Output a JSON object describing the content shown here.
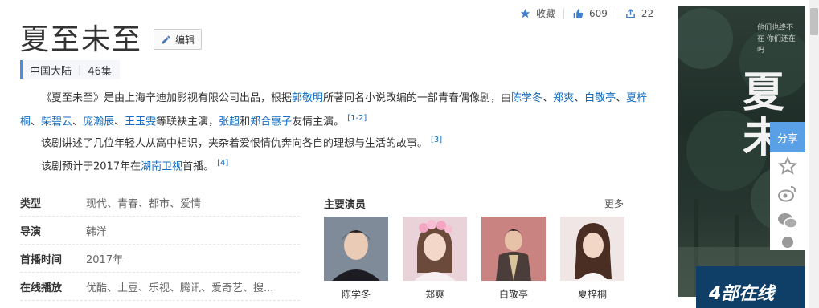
{
  "actions": {
    "favorite": "收藏",
    "likes": "609",
    "shares": "22"
  },
  "title": "夏至未至",
  "edit_label": "编辑",
  "tags": [
    "中国大陆",
    "46集"
  ],
  "intro": {
    "p1": {
      "s1": "《夏至未至》是由上海辛迪加影视有限公司出品，根据",
      "l1": "郭敬明",
      "s2": "所著同名小说改编的一部青春偶像剧，由",
      "l2": "陈学冬",
      "s3": "、",
      "l3": "郑爽",
      "s4": "、",
      "l4": "白敬亭",
      "s5": "、",
      "l5": "夏梓桐",
      "s6": "、",
      "l6": "柴碧云",
      "s7": "、",
      "l7": "庞瀚辰",
      "s8": "、",
      "l8": "王玉雯",
      "s9": "等联袂主演，",
      "l9": "张超",
      "s10": "和",
      "l10": "郑合惠子",
      "s11": "友情主演。",
      "ref": "[1-2]"
    },
    "p2": {
      "text": "该剧讲述了几位年轻人从高中相识，夹杂着爱恨情仇奔向各自的理想与生活的故事。",
      "ref": "[3]"
    },
    "p3": {
      "s1": "该剧预计于2017年在",
      "link": "湖南卫视",
      "s2": "首播。",
      "ref": "[4]"
    }
  },
  "info": [
    {
      "key": "类型",
      "value": "现代、青春、都市、爱情"
    },
    {
      "key": "导演",
      "value": "韩洋"
    },
    {
      "key": "首播时间",
      "value": "2017年"
    },
    {
      "key": "在线播放",
      "value": "优酷、土豆、乐视、腾讯、爱奇艺、搜..."
    }
  ],
  "cast": {
    "title": "主要演员",
    "more": "更多",
    "members": [
      {
        "name": "陈学冬",
        "bg": "#8a96a3"
      },
      {
        "name": "郑爽",
        "bg": "#e8c9cf"
      },
      {
        "name": "白敬亭",
        "bg": "#c98a88"
      },
      {
        "name": "夏梓桐",
        "bg": "#e9dede"
      }
    ]
  },
  "poster": {
    "big_text": "夏未",
    "small_text": "他们也终不在 你们还在吗",
    "banner": "4部在线"
  },
  "share": {
    "label": "分享"
  },
  "colors": {
    "link": "#136ec2",
    "accent": "#4a90e2",
    "share": "#5aa0e6"
  }
}
